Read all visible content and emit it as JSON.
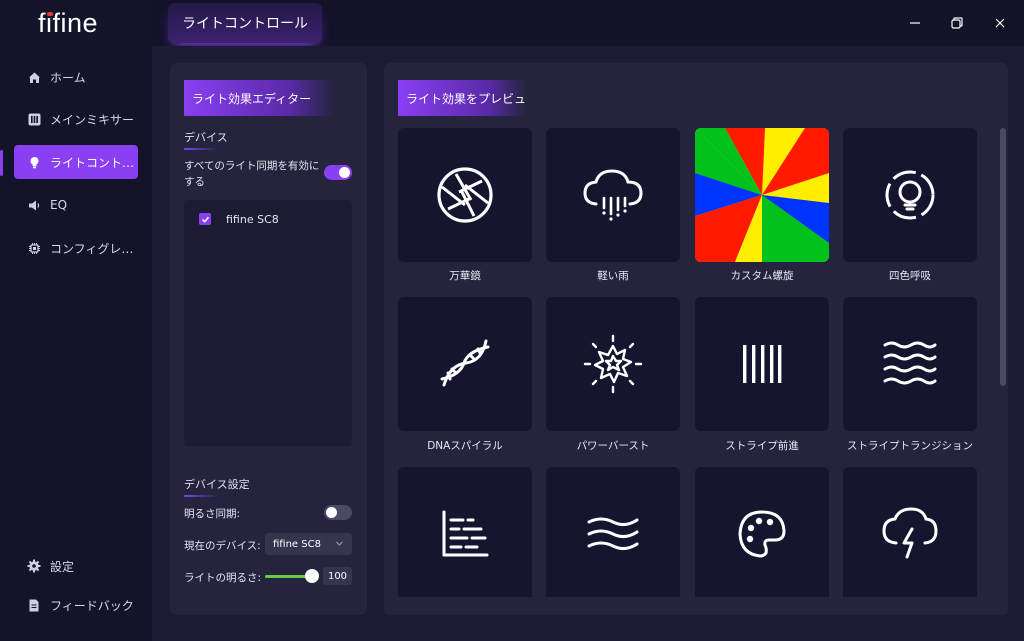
{
  "app": {
    "logo": "fifine"
  },
  "sidebar": {
    "items": [
      {
        "label": "ホーム",
        "icon": "home-icon"
      },
      {
        "label": "メインミキサー",
        "icon": "mixer-icon"
      },
      {
        "label": "ライトコント…",
        "icon": "lightbulb-icon",
        "active": true
      },
      {
        "label": "EQ",
        "icon": "speaker-icon"
      },
      {
        "label": "コンフィグレ…",
        "icon": "chip-icon"
      }
    ],
    "bottom": [
      {
        "label": "設定",
        "icon": "gear-icon"
      },
      {
        "label": "フィードバック",
        "icon": "document-icon"
      }
    ]
  },
  "header": {
    "title": "ライトコントロール"
  },
  "editor": {
    "title": "ライト効果エディター",
    "device_heading": "デバイス",
    "sync_all_label": "すべてのライト同期を有効にする",
    "sync_all_on": true,
    "devices": [
      {
        "name": "fifine SC8",
        "checked": true
      }
    ],
    "settings_heading": "デバイス設定",
    "brightness_sync_label": "明るさ同期:",
    "brightness_sync_on": false,
    "current_device_label": "現在のデバイス:",
    "current_device_value": "fifine SC8",
    "brightness_label": "ライトの明るさ:",
    "brightness_value": "100",
    "brightness_level": 1.0
  },
  "preview": {
    "title": "ライト効果をプレビュ",
    "effects": [
      {
        "label": "万華鏡",
        "icon": "aperture-icon"
      },
      {
        "label": "軽い雨",
        "icon": "rain-cloud-icon"
      },
      {
        "label": "カスタム螺旋",
        "icon": "color-pinwheel-icon"
      },
      {
        "label": "四色呼吸",
        "icon": "breathing-bulb-icon"
      },
      {
        "label": "DNAスパイラル",
        "icon": "dna-icon"
      },
      {
        "label": "パワーバースト",
        "icon": "burst-icon"
      },
      {
        "label": "ストライプ前進",
        "icon": "vertical-stripes-icon"
      },
      {
        "label": "ストライプトランジション",
        "icon": "waves-icon"
      },
      {
        "label": "",
        "icon": "bar-chart-icon"
      },
      {
        "label": "",
        "icon": "three-waves-icon"
      },
      {
        "label": "",
        "icon": "palette-icon"
      },
      {
        "label": "",
        "icon": "storm-cloud-icon"
      }
    ]
  },
  "colors": {
    "accent": "#8a3ff2",
    "slider": "#66cc44",
    "panel": "#24243f",
    "tile": "#151530"
  }
}
